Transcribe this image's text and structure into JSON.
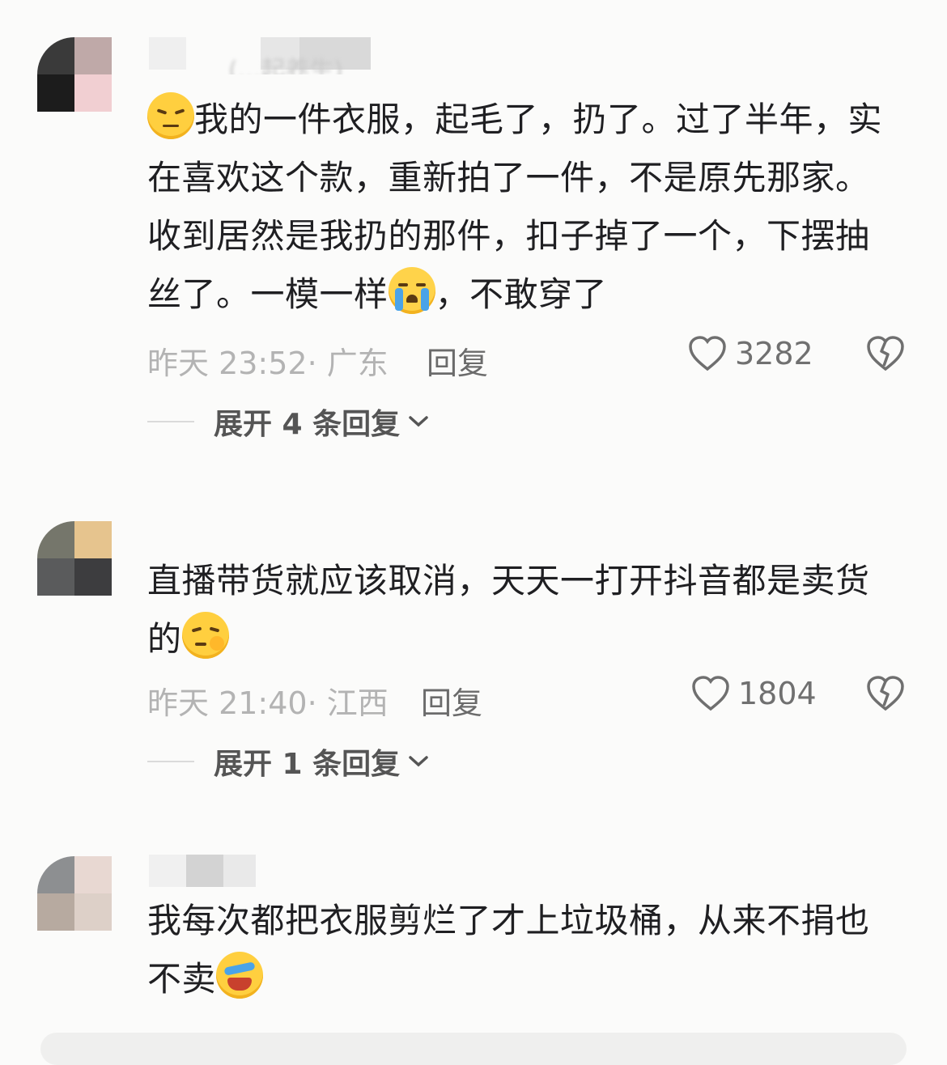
{
  "comments": [
    {
      "username_fragment": "(...起养生)",
      "text_before": "我的一件衣服，起毛了，扔了。过了半年，实在喜欢这个款，重新拍了一件，不是原先那家。收到居然是我扔的那件，扣子掉了一个，下摆抽丝了。一模一样",
      "text_after": "，不敢穿了",
      "lead_emoji": "annoyed-face-icon",
      "inline_emoji": "crying-face-icon",
      "time": "昨天 23:52",
      "location": "广东",
      "reply_label": "回复",
      "likes": "3282",
      "expand_label": "展开 4 条回复"
    },
    {
      "text_before": "直播带货就应该取消，天天一打开抖音都是卖货的",
      "inline_emoji": "smirking-face-icon",
      "time": "昨天 21:40",
      "location": "江西",
      "reply_label": "回复",
      "likes": "1804",
      "expand_label": "展开 1 条回复"
    },
    {
      "text_before": "我每次都把衣服剪烂了才上垃圾桶，从来不捐也不卖",
      "inline_emoji": "laughing-crying-face-icon"
    }
  ],
  "colors": {
    "background": "#fbfbfa",
    "text": "#1f1f22",
    "meta": "#b3b3b3",
    "emoji": "#ffcf3f"
  }
}
